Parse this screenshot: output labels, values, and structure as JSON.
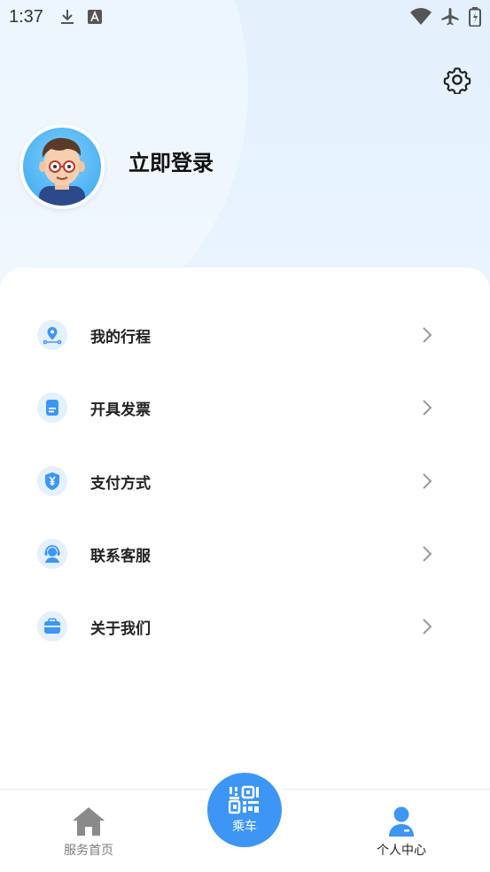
{
  "status_bar": {
    "time": "1:37",
    "icons": [
      "download-icon",
      "font-a-icon",
      "wifi-icon",
      "airplane-icon",
      "battery-charging-icon"
    ]
  },
  "header": {
    "login_text": "立即登录",
    "settings_icon": "gear-icon",
    "avatar_icon": "user-avatar"
  },
  "menu": {
    "items": [
      {
        "label": "我的行程",
        "icon": "location-pin-icon"
      },
      {
        "label": "开具发票",
        "icon": "document-icon"
      },
      {
        "label": "支付方式",
        "icon": "yuan-shield-icon"
      },
      {
        "label": "联系客服",
        "icon": "headset-agent-icon"
      },
      {
        "label": "关于我们",
        "icon": "briefcase-icon"
      }
    ]
  },
  "tabbar": {
    "home_label": "服务首页",
    "ride_label": "乘车",
    "profile_label": "个人中心"
  },
  "colors": {
    "accent": "#3d96f5",
    "header_bg": "#e3f1fd",
    "tab_inactive": "#7d7d7d",
    "tab_active": "#222222"
  }
}
